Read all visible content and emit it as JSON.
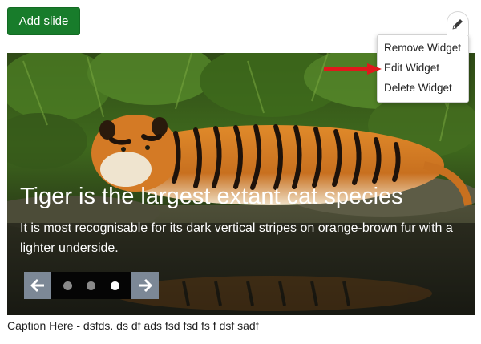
{
  "toolbar": {
    "add_slide_label": "Add slide"
  },
  "widget_menu": {
    "toggle_icon": "pencil-icon",
    "items": [
      {
        "label": "Remove Widget"
      },
      {
        "label": "Edit Widget"
      },
      {
        "label": "Delete Widget"
      }
    ]
  },
  "annotation": {
    "icon": "red-arrow-pointing-right",
    "color": "#e0191b",
    "points_to": "Edit Widget"
  },
  "slider": {
    "image": "tiger-lying-by-water",
    "slide_title": "Tiger is the largest extant cat species",
    "slide_description": "It is most recognisable for its dark vertical stripes on orange-brown fur with a lighter underside.",
    "controls": {
      "prev_icon": "arrow-left-icon",
      "next_icon": "arrow-right-icon",
      "dot_count": 3,
      "active_dot": 3
    }
  },
  "caption": {
    "text": "Caption Here - dsfds. ds df ads fsd fsd fs f dsf sadf"
  },
  "colors": {
    "add_button": "#187c2b",
    "control_arrows": "#7c8896",
    "control_dots_bg": "#050505",
    "active_dot": "#ffffff",
    "inactive_dot": "#8a8a8a"
  }
}
